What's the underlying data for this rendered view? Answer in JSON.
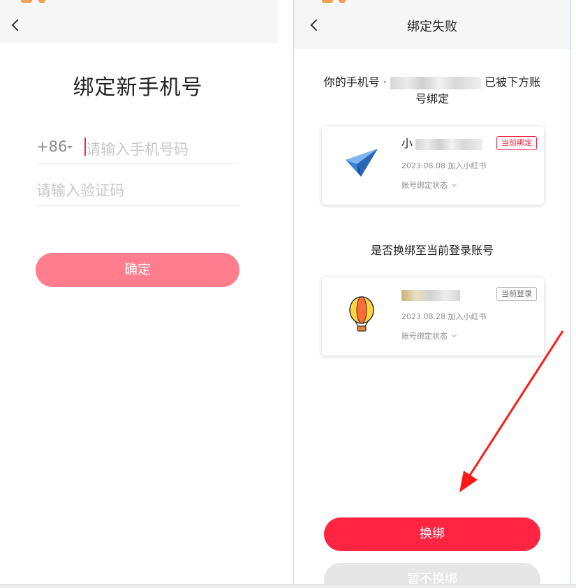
{
  "colors": {
    "accent": "#ff2442",
    "confirm_disabled": "#ff7d8c",
    "annotation_arrow": "#ff1a1a"
  },
  "left": {
    "title": "绑定新手机号",
    "country_code": "+86",
    "phone_placeholder": "请输入手机号码",
    "code_placeholder": "请输入验证码",
    "confirm_label": "确定"
  },
  "right": {
    "title": "绑定失败",
    "message_prefix": "你的手机号 ·",
    "message_suffix_1": "已被下方账",
    "message_suffix_2": "号绑定",
    "question": "是否换绑至当前登录账号",
    "accounts": [
      {
        "name_prefix": "小",
        "joined": "2023.08.08 加入小红书",
        "state": "账号绑定状态",
        "badge": "当前绑定",
        "avatar_icon": "paper-plane-icon"
      },
      {
        "name_prefix": "",
        "joined": "2023.08.28 加入小红书",
        "state": "账号绑定状态",
        "badge": "当前登录",
        "avatar_icon": "hot-air-balloon-icon"
      }
    ],
    "rebind_label": "换绑",
    "later_label": "暂不换绑"
  }
}
